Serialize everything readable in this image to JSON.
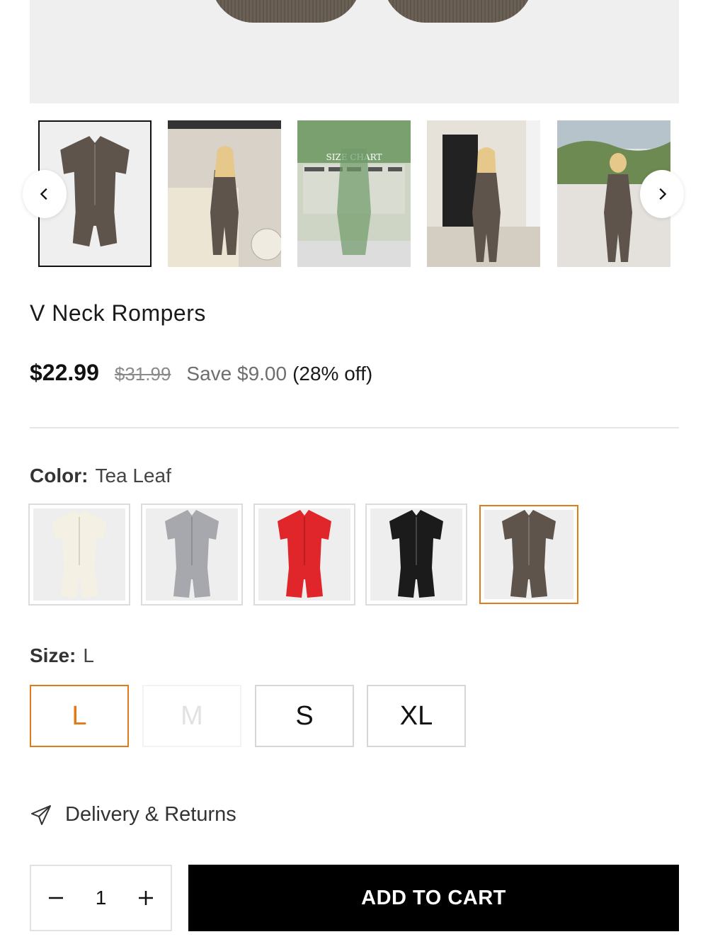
{
  "product": {
    "title": "V Neck Rompers",
    "price": "$22.99",
    "compare_price": "$31.99",
    "save_text": "Save $9.00",
    "discount_text": "(28% off)"
  },
  "gallery": {
    "thumbnails": [
      {
        "name": "romper-product-shot",
        "selected": true
      },
      {
        "name": "model-by-car"
      },
      {
        "name": "size-chart",
        "text": "SIZE CHART"
      },
      {
        "name": "model-front-doorway"
      },
      {
        "name": "model-back-view"
      }
    ],
    "prev_icon": "chevron-left-icon",
    "next_icon": "chevron-right-icon"
  },
  "color": {
    "label": "Color:",
    "selected": "Tea Leaf",
    "swatches": [
      {
        "color": "#f4f0e3"
      },
      {
        "color": "#a7a8ad"
      },
      {
        "color": "#e0262a"
      },
      {
        "color": "#1b1b1b"
      },
      {
        "color": "#5e544b",
        "selected": true
      }
    ]
  },
  "size": {
    "label": "Size:",
    "selected": "L",
    "options": [
      {
        "label": "L",
        "state": "selected"
      },
      {
        "label": "M",
        "state": "disabled"
      },
      {
        "label": "S",
        "state": "available"
      },
      {
        "label": "XL",
        "state": "available"
      }
    ]
  },
  "delivery": {
    "label": "Delivery & Returns",
    "icon": "paper-plane-icon"
  },
  "cart": {
    "quantity": "1",
    "minus_icon": "minus-icon",
    "plus_icon": "plus-icon",
    "add_label": "ADD TO CART"
  },
  "colors": {
    "accent": "#e07b1a",
    "button_bg": "#000000"
  }
}
